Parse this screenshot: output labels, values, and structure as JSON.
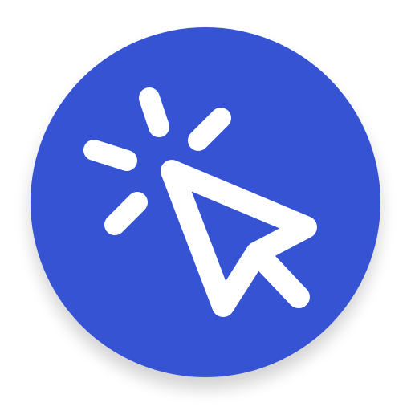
{
  "icon": {
    "name": "click-cursor-icon",
    "description_role": "app-icon",
    "background_color": "#3652D3",
    "glyph_color": "#FFFFFF"
  }
}
